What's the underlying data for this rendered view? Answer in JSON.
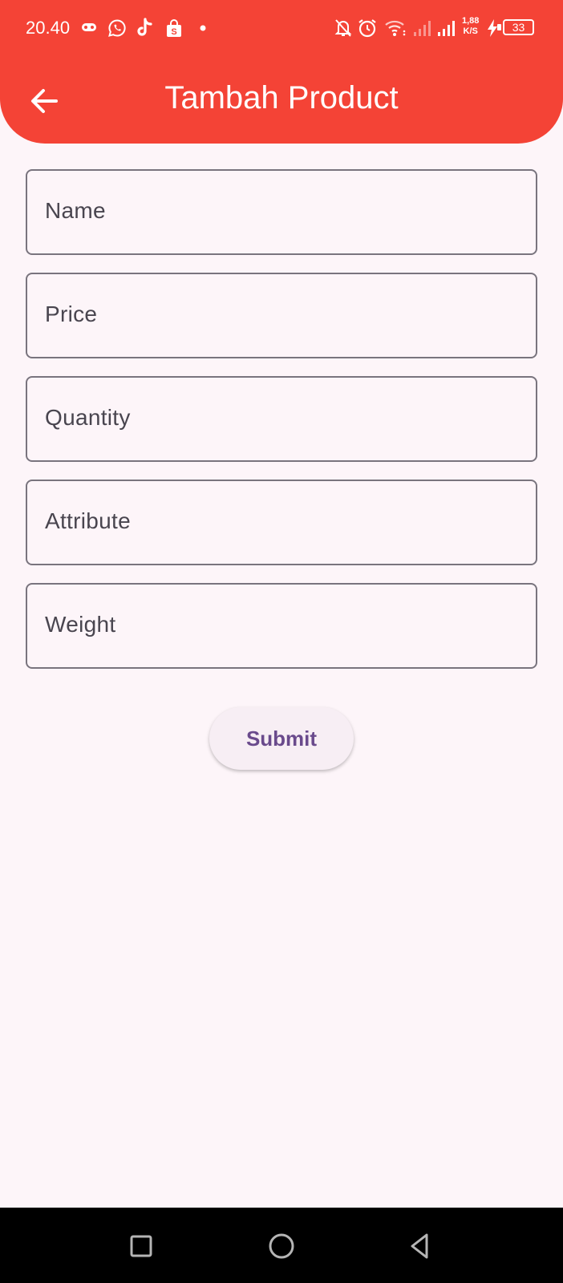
{
  "status_bar": {
    "time": "20.40",
    "net_speed_value": "1,88",
    "net_speed_unit": "K/S",
    "battery": "33",
    "icons": [
      "game-icon",
      "whatsapp-icon",
      "tiktok-icon",
      "shopping-bag-icon",
      "notification-dot",
      "mute-icon",
      "alarm-icon",
      "wifi-icon",
      "signal-icon",
      "signal-icon",
      "charging-icon",
      "battery-icon"
    ]
  },
  "app_bar": {
    "title": "Tambah Product",
    "back_icon": "arrow-back-icon",
    "color": "#f44336"
  },
  "form": {
    "fields": [
      {
        "label": "Name"
      },
      {
        "label": "Price"
      },
      {
        "label": "Quantity"
      },
      {
        "label": "Attribute"
      },
      {
        "label": "Weight"
      }
    ],
    "submit_label": "Submit"
  },
  "nav_bar": {
    "buttons": [
      "recents-icon",
      "home-icon",
      "back-icon"
    ]
  },
  "colors": {
    "accent": "#f44336",
    "background": "#fdf5f9",
    "button_text": "#6a4a8c",
    "outline": "#79747e"
  }
}
